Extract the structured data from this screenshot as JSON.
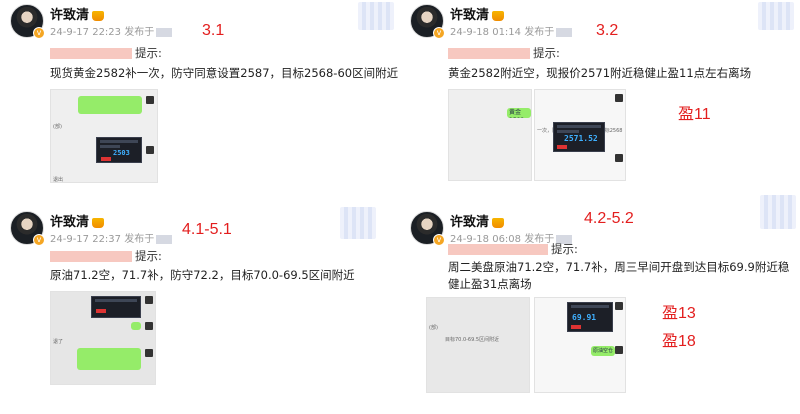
{
  "posts": [
    {
      "author": "许致清",
      "date": "24-9-17 22:23",
      "published": "发布于",
      "label": "3.1",
      "hint": "提示:",
      "text": "现货黄金2582补一次，防守同意设置2587，目标2568-60区间附近",
      "shot": {
        "price": "2503",
        "tag": "退出"
      }
    },
    {
      "author": "许致清",
      "date": "24-9-18 01:14",
      "published": "发布于",
      "label": "3.2",
      "hint": "提示:",
      "text": "黄金2582附近空，现报价2571附近稳健止盈11点左右离场",
      "profit": [
        "盈11"
      ],
      "shot": {
        "price": "2571.52",
        "bubble": "黄金2582",
        "note": "一次，防守同意设置2587，目标2568"
      }
    },
    {
      "author": "许致清",
      "date": "24-9-17 22:37",
      "published": "发布于",
      "label": "4.1-5.1",
      "hint": "提示:",
      "text": "原油71.2空，71.7补，防守72.2，目标70.0-69.5区间附近",
      "shot": {
        "tag": "退了"
      }
    },
    {
      "author": "许致清",
      "date": "24-9-18 06:08",
      "published": "发布于",
      "label": "4.2-5.2",
      "hint": "提示:",
      "text": "周二美盘原油71.2空，71.7补，周三早间开盘到达目标69.9附近稳健止盈31点离场",
      "profit": [
        "盈13",
        "盈18"
      ],
      "shot": {
        "price": "69.91",
        "bubble": "原油空仓",
        "note": "目标70.0-69.5区间附近"
      }
    }
  ],
  "colors": {
    "accent_red": "#e31e1e",
    "wechat_green": "#95ec69",
    "terminal_bg": "#1c1f27",
    "price_blue": "#3fb0ff"
  }
}
